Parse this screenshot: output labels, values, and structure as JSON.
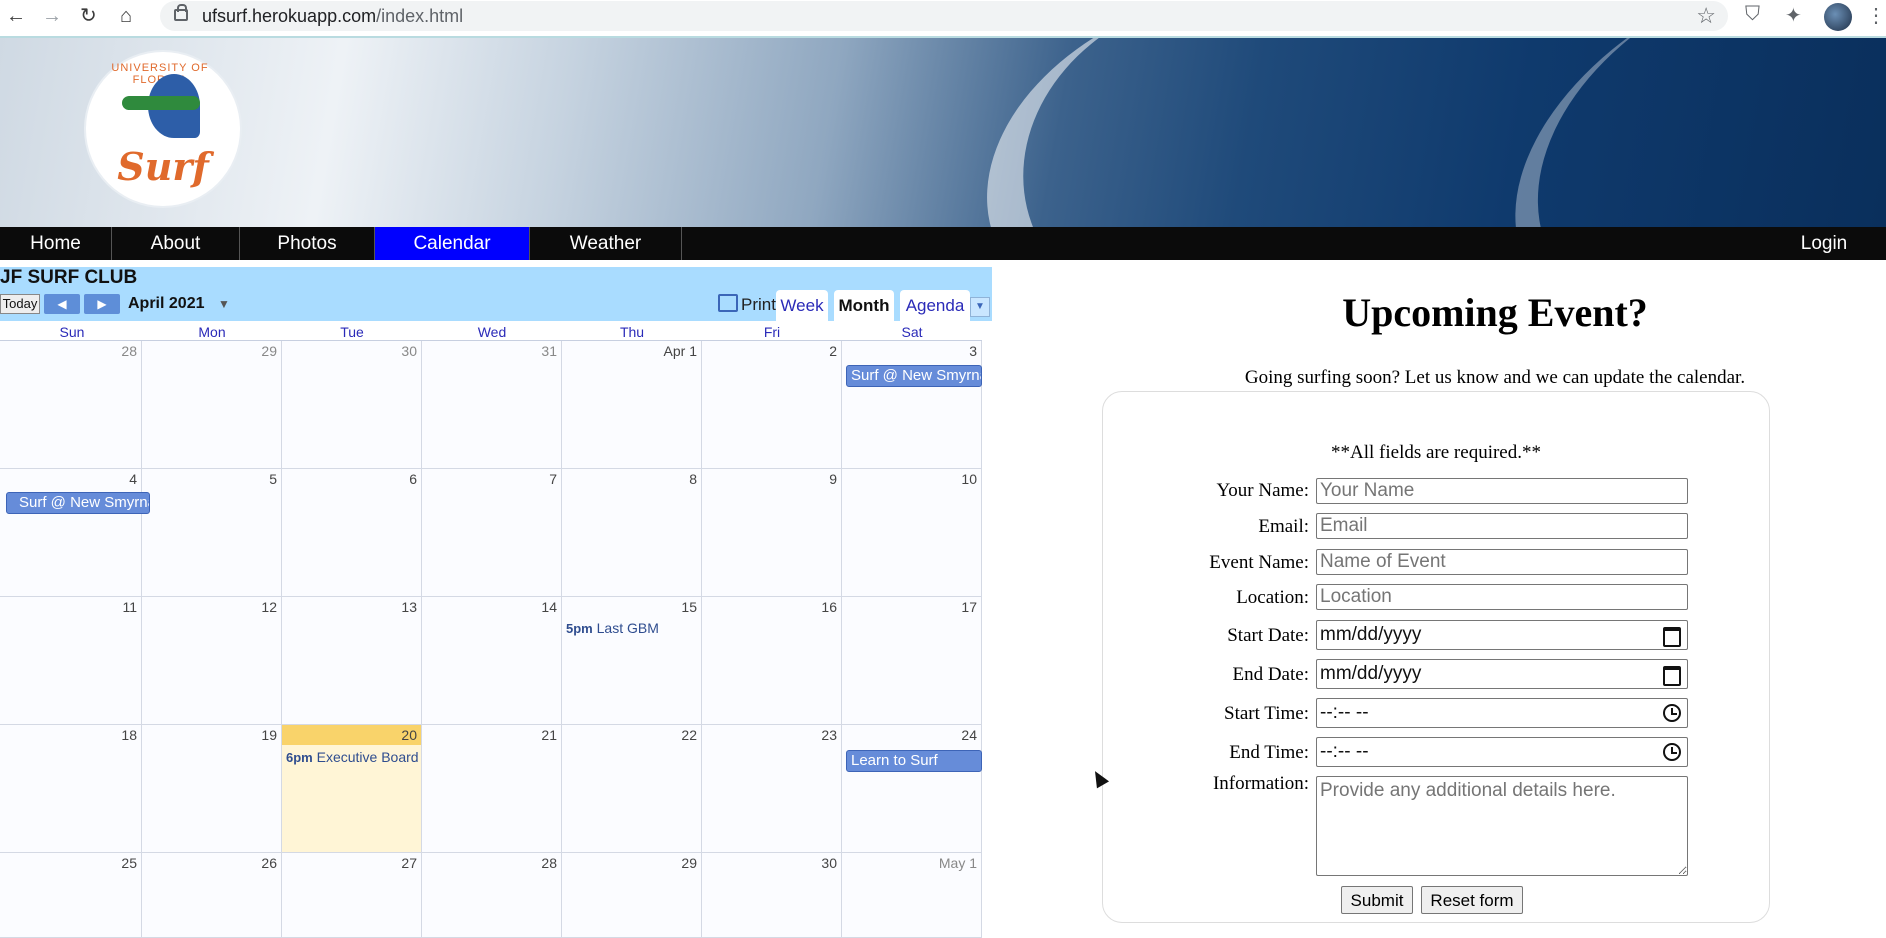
{
  "browser": {
    "url_host": "ufsurf.herokuapp.com",
    "url_path": "/index.html"
  },
  "header": {
    "logo_ring_text": "UNIVERSITY OF FLORIDA",
    "logo_script_text": "Surf"
  },
  "nav": {
    "items": [
      {
        "label": "Home"
      },
      {
        "label": "About"
      },
      {
        "label": "Photos"
      },
      {
        "label": "Calendar"
      },
      {
        "label": "Weather"
      }
    ],
    "active": "Calendar",
    "login": "Login"
  },
  "calendar": {
    "title": "JF SURF CLUB",
    "today_button": "Today",
    "month": "April 2021",
    "print": "Print",
    "tabs": [
      "Week",
      "Month",
      "Agenda"
    ],
    "selected_tab": "Month",
    "days_of_week": [
      "Sun",
      "Mon",
      "Tue",
      "Wed",
      "Thu",
      "Fri",
      "Sat"
    ],
    "weeks": [
      [
        "28",
        "29",
        "30",
        "31",
        "Apr 1",
        "2",
        "3"
      ],
      [
        "4",
        "5",
        "6",
        "7",
        "8",
        "9",
        "10"
      ],
      [
        "11",
        "12",
        "13",
        "14",
        "15",
        "16",
        "17"
      ],
      [
        "18",
        "19",
        "20",
        "21",
        "22",
        "23",
        "24"
      ],
      [
        "25",
        "26",
        "27",
        "28",
        "29",
        "30",
        "May 1"
      ]
    ],
    "today_label": "20",
    "events": {
      "surf_new_smyrna_1": "Surf @ New Smyrna",
      "surf_new_smyrna_2": "Surf @ New Smyrna",
      "last_gbm_time": "5pm",
      "last_gbm_title": "Last GBM",
      "exec_board_time": "6pm",
      "exec_board_title": "Executive Board",
      "learn_to_surf": "Learn to Surf"
    },
    "colors": {
      "header_bg": "#a9dcff",
      "event_bar": "#668cd9",
      "today_bg": "#fff5d6"
    }
  },
  "form": {
    "heading": "Upcoming Event?",
    "subheading": "Going surfing soon? Let us know and we can update the calendar.",
    "required_note": "**All fields are required.**",
    "labels": {
      "name": "Your Name:",
      "email": "Email:",
      "event_name": "Event Name:",
      "location": "Location:",
      "start_date": "Start Date:",
      "end_date": "End Date:",
      "start_time": "Start Time:",
      "end_time": "End Time:",
      "information": "Information:"
    },
    "placeholders": {
      "name": "Your Name",
      "email": "Email",
      "event_name": "Name of Event",
      "location": "Location",
      "start_date": "mm/dd/yyyy",
      "end_date": "mm/dd/yyyy",
      "start_time": "--:-- --",
      "end_time": "--:-- --",
      "information": "Provide any additional details here."
    },
    "submit": "Submit",
    "reset": "Reset form"
  }
}
